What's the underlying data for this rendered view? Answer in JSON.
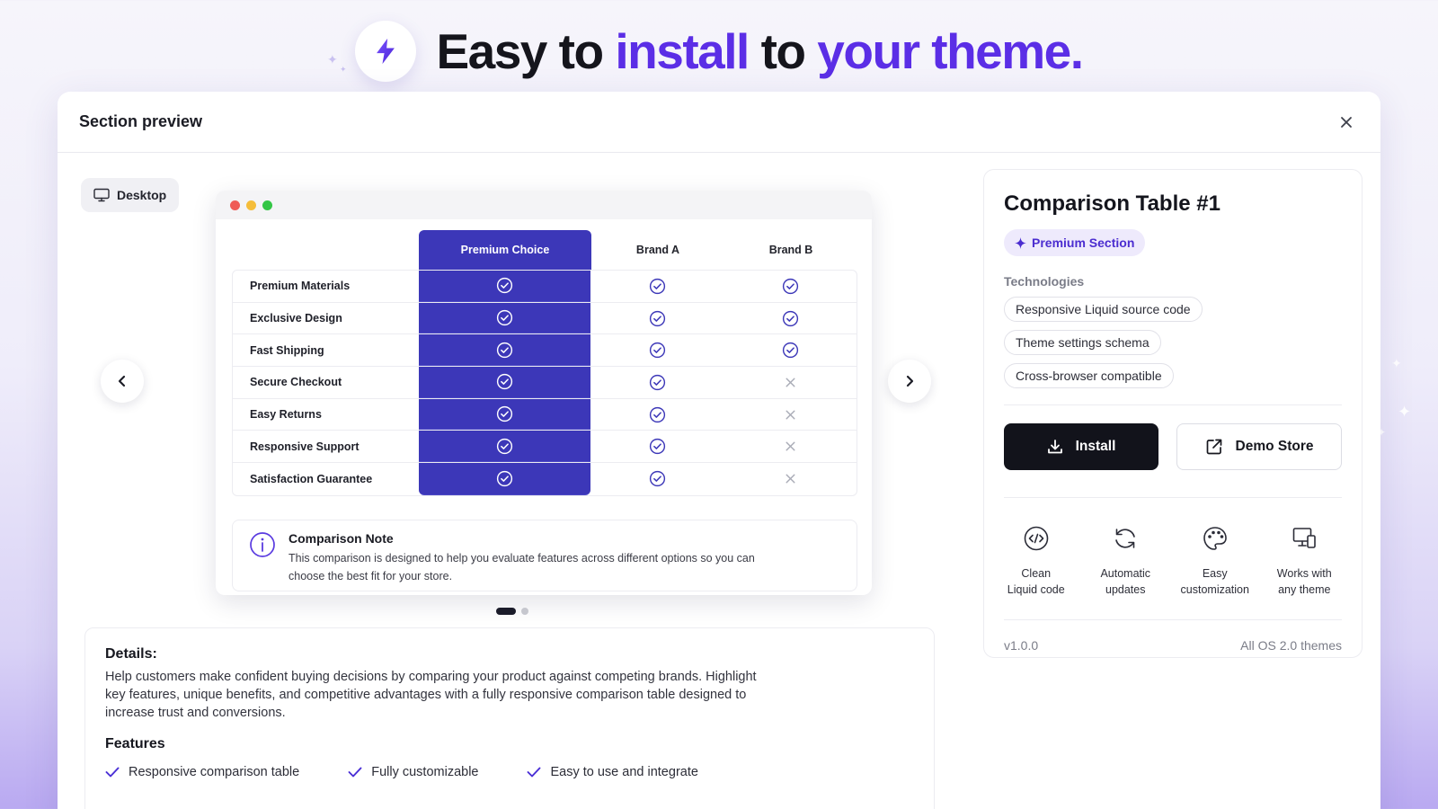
{
  "hero": {
    "title_part1": "Easy to ",
    "title_part2": "install",
    "title_part3": " to ",
    "title_part4": "your theme.",
    "icon": "lightning-icon"
  },
  "panel": {
    "title": "Section preview",
    "close_icon": "close-icon"
  },
  "viewport": {
    "label": "Desktop",
    "icon": "monitor-icon"
  },
  "comparison": {
    "columns": [
      "Premium Choice",
      "Brand A",
      "Brand B"
    ],
    "rows": [
      {
        "feature": "Premium Materials",
        "premium": true,
        "brand_a": true,
        "brand_b": true
      },
      {
        "feature": "Exclusive Design",
        "premium": true,
        "brand_a": true,
        "brand_b": true
      },
      {
        "feature": "Fast Shipping",
        "premium": true,
        "brand_a": true,
        "brand_b": true
      },
      {
        "feature": "Secure Checkout",
        "premium": true,
        "brand_a": true,
        "brand_b": false
      },
      {
        "feature": "Easy Returns",
        "premium": true,
        "brand_a": true,
        "brand_b": false
      },
      {
        "feature": "Responsive Support",
        "premium": true,
        "brand_a": true,
        "brand_b": false
      },
      {
        "feature": "Satisfaction Guarantee",
        "premium": true,
        "brand_a": true,
        "brand_b": false
      }
    ],
    "note_title": "Comparison Note",
    "note_text": "This comparison is designed to help you evaluate features across different options so you can choose the best fit for your store."
  },
  "carousel": {
    "active_index": 1,
    "total": 2
  },
  "details": {
    "heading": "Details:",
    "description": "Help customers make confident buying decisions by comparing your product against competing brands. Highlight key features, unique benefits, and competitive advantages with a fully responsive comparison table designed to increase trust and conversions.",
    "features_heading": "Features",
    "features": [
      "Responsive comparison table",
      "Fully customizable",
      "Easy to use and integrate"
    ]
  },
  "sidebar": {
    "title": "Comparison Table #1",
    "badge": "Premium Section",
    "technologies_label": "Technologies",
    "technologies": [
      "Responsive Liquid source code",
      "Theme settings schema",
      "Cross-browser compatible"
    ],
    "install_label": "Install",
    "demo_label": "Demo Store",
    "benefits": [
      {
        "line1": "Clean",
        "line2": "Liquid code",
        "icon": "code-icon"
      },
      {
        "line1": "Automatic",
        "line2": "updates",
        "icon": "refresh-icon"
      },
      {
        "line1": "Easy",
        "line2": "customization",
        "icon": "palette-icon"
      },
      {
        "line1": "Works with",
        "line2": "any theme",
        "icon": "devices-icon"
      }
    ],
    "version": "v1.0.0",
    "compat": "All OS 2.0 themes"
  },
  "colors": {
    "accent": "#5b2ee6",
    "premium_column": "#3c37b8",
    "install_button": "#12131b"
  }
}
